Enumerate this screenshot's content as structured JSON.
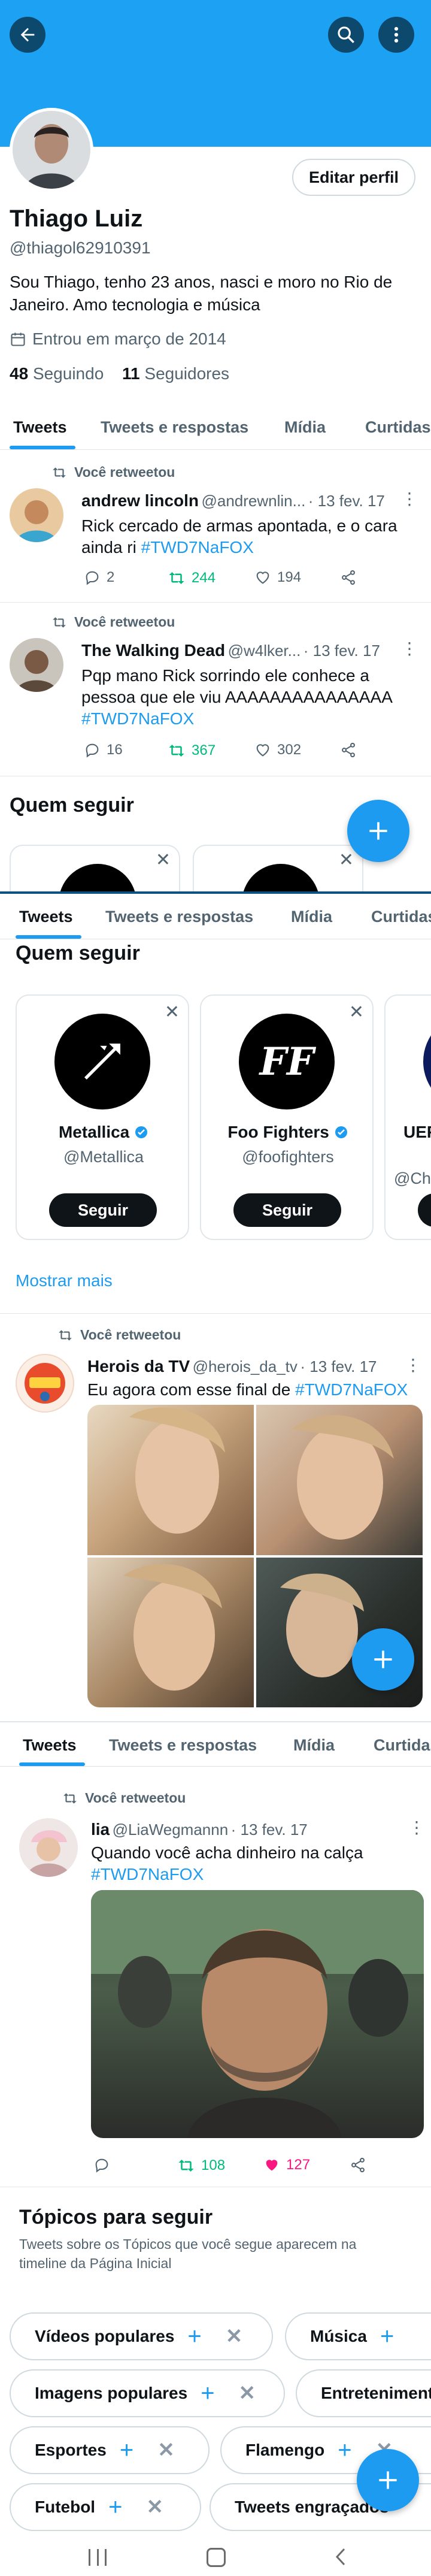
{
  "profile": {
    "name": "Thiago Luiz",
    "handle": "@thiagol62910391",
    "bio": "Sou Thiago, tenho 23 anos, nasci e moro no Rio de Janeiro. Amo tecnologia e música",
    "joined": "Entrou em março de 2014",
    "following_count": "48",
    "following_label": "Seguindo",
    "followers_count": "11",
    "followers_label": "Seguidores",
    "edit_label": "Editar perfil"
  },
  "tabs": [
    "Tweets",
    "Tweets e respostas",
    "Mídia",
    "Curtidas"
  ],
  "retweet_label": "Você retweetou",
  "tweets": [
    {
      "name": "andrew lincoln",
      "handle": "@andrewnlin...",
      "date": "· 13 fev. 17",
      "text": "Rick cercado de armas apontada, e o cara ainda ri ",
      "hashtag": "#TWD7NaFOX",
      "replies": "2",
      "retweets": "244",
      "likes": "194"
    },
    {
      "name": "The Walking Dead",
      "handle": "@w4lker...",
      "date": "· 13 fev. 17",
      "text": "Pqp mano Rick sorrindo ele conhece a pessoa que ele viu AAAAAAAAAAAAAAA ",
      "hashtag": "#TWD7NaFOX",
      "replies": "16",
      "retweets": "367",
      "likes": "302"
    },
    {
      "name": "Herois da TV",
      "handle": "@herois_da_tv",
      "date": "· 13 fev. 17",
      "text": "Eu agora com esse final de ",
      "hashtag": "#TWD7NaFOX"
    },
    {
      "name": "lia",
      "handle": "@LiaWegmannn",
      "date": "· 13 fev. 17",
      "text": "Quando você acha dinheiro na calça ",
      "hashtag": "#TWD7NaFOX",
      "retweets": "108",
      "likes": "127"
    }
  ],
  "who_to_follow": {
    "title": "Quem seguir",
    "show_more": "Mostrar mais",
    "follow_label": "Seguir",
    "accounts": [
      {
        "name": "Metallica",
        "handle": "@Metallica"
      },
      {
        "name": "Foo Fighters",
        "handle": "@foofighters"
      },
      {
        "name": "UEF",
        "handle": "@Cha"
      }
    ]
  },
  "topics": {
    "title": "Tópicos para seguir",
    "subtitle": "Tweets sobre os Tópicos que você segue aparecem na timeline da Página Inicial",
    "chips": [
      "Vídeos populares",
      "Música",
      "Imagens populares",
      "Entretenimento",
      "Esportes",
      "Flamengo",
      "Futebol",
      "Tweets engraçados"
    ]
  },
  "colors": {
    "accent": "#1d9bf0",
    "header": "#1da1f2",
    "retweet": "#00ba7c",
    "like": "#f91880"
  }
}
